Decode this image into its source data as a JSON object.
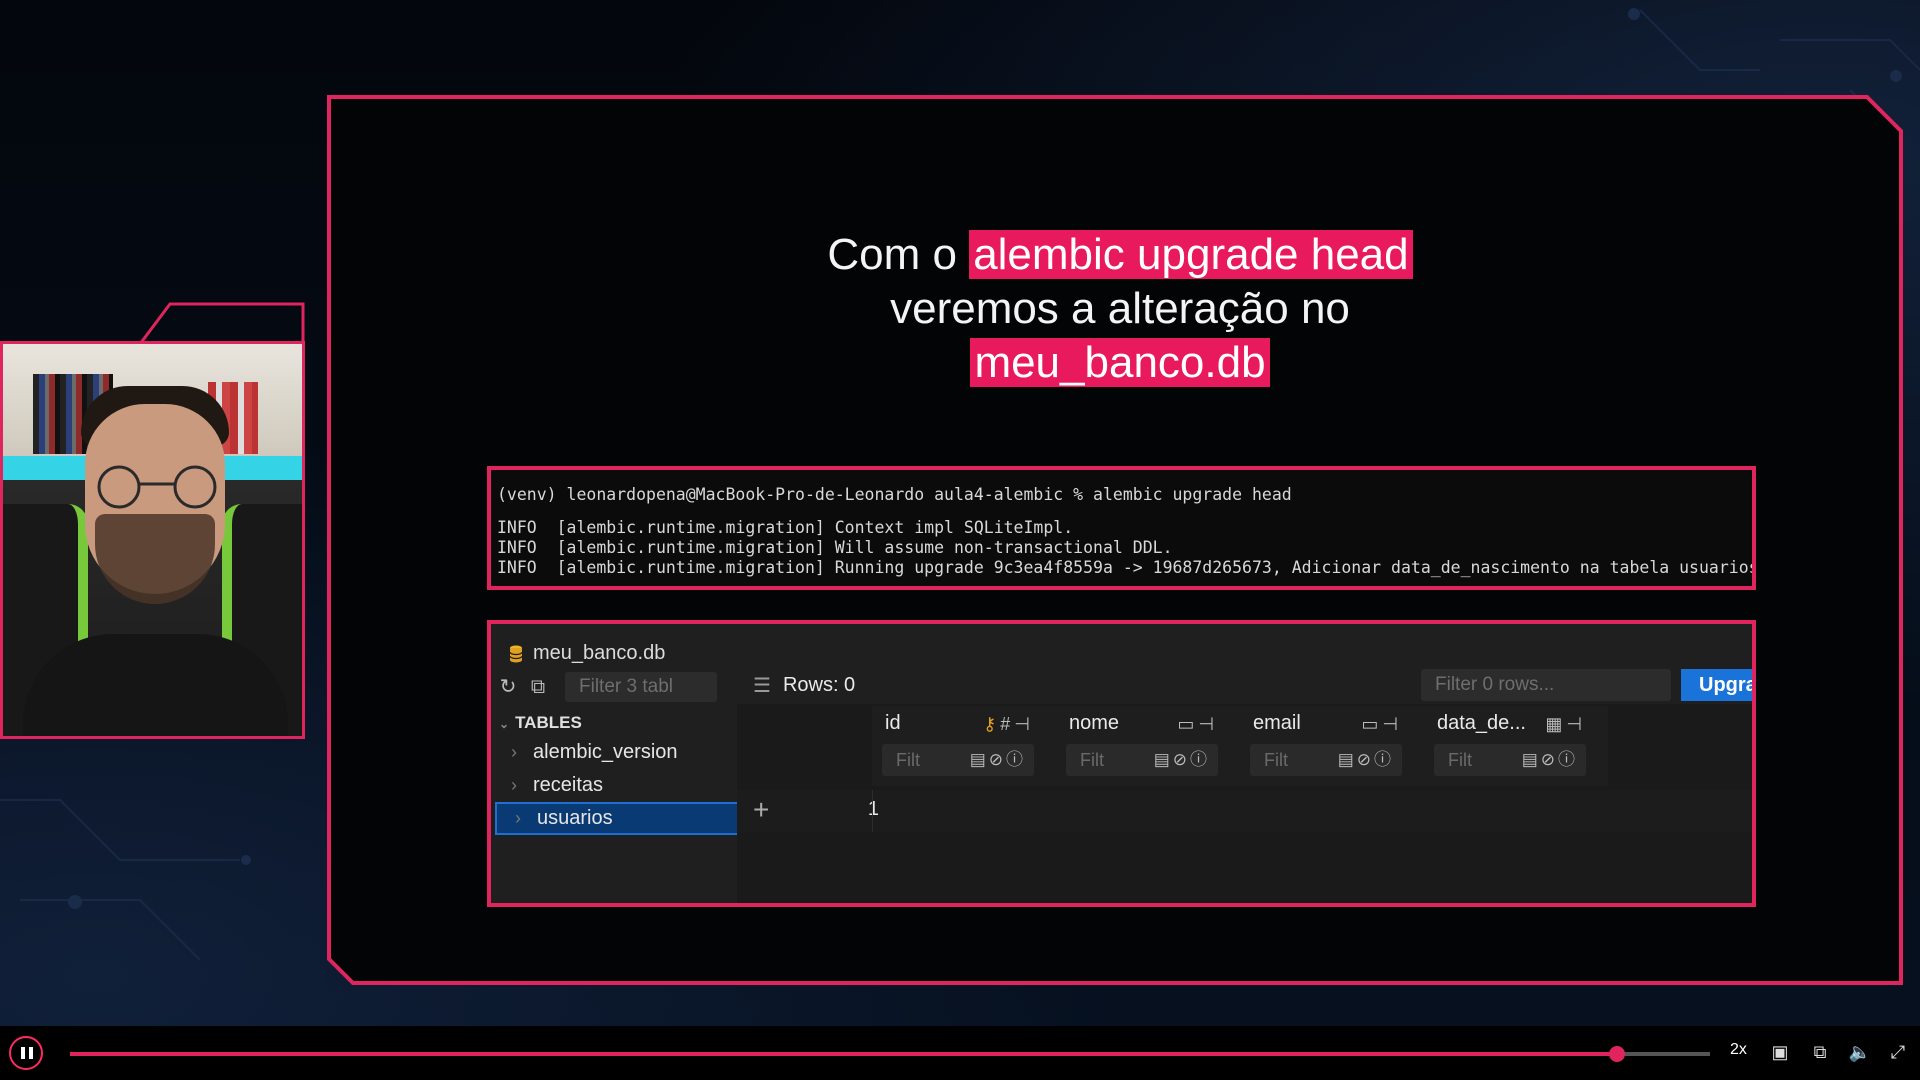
{
  "headline": {
    "line1_prefix": "Com o ",
    "line1_highlight": "alembic upgrade head",
    "line2": "veremos a alteração no",
    "line3_highlight": "meu_banco.db"
  },
  "terminal": {
    "prompt_line": "(venv) leonardopena@MacBook-Pro-de-Leonardo aula4-alembic % alembic upgrade head",
    "lines": [
      "INFO  [alembic.runtime.migration] Context impl SQLiteImpl.",
      "INFO  [alembic.runtime.migration] Will assume non-transactional DDL.",
      "INFO  [alembic.runtime.migration] Running upgrade 9c3ea4f8559a -> 19687d265673, Adicionar data_de_nascimento na tabela usuarios"
    ]
  },
  "db_viewer": {
    "file_name": "meu_banco.db",
    "filter_tables_placeholder": "Filter 3 tabl",
    "tables_header": "TABLES",
    "tables": [
      {
        "name": "alembic_version",
        "selected": false
      },
      {
        "name": "receitas",
        "selected": false
      },
      {
        "name": "usuarios",
        "selected": true
      }
    ],
    "rows_label": "Rows: 0",
    "filter_rows_placeholder": "Filter 0 rows...",
    "upgrade_button": "Upgrade",
    "columns": [
      {
        "name": "id",
        "filter_placeholder": "Filt"
      },
      {
        "name": "nome",
        "filter_placeholder": "Filt"
      },
      {
        "name": "email",
        "filter_placeholder": "Filt"
      },
      {
        "name": "data_de...",
        "filter_placeholder": "Filt"
      }
    ],
    "row_number": "1"
  },
  "player": {
    "progress_fraction": 0.943,
    "speed_label": "2x"
  },
  "colors": {
    "accent": "#e0245e",
    "highlight_bg": "#e8195c",
    "selected_row": "#0a3a73",
    "upgrade_button": "#1a73d8"
  }
}
